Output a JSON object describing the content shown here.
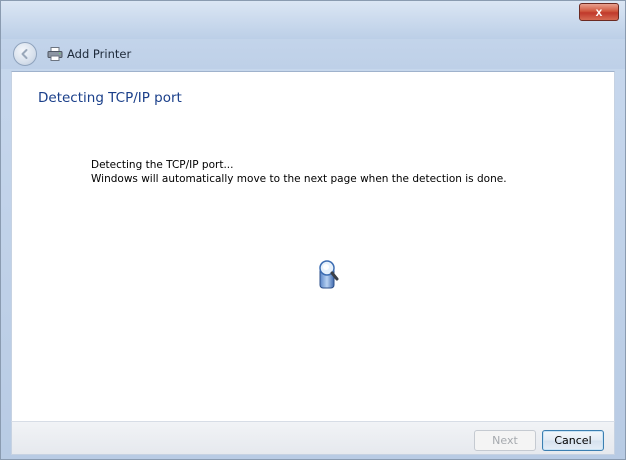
{
  "window": {
    "title": "Add Printer",
    "close_label": "x"
  },
  "page": {
    "heading": "Detecting TCP/IP port",
    "status_line1": "Detecting the TCP/IP port...",
    "status_line2": "Windows will automatically move to the next page when the detection is done."
  },
  "buttons": {
    "next_label": "Next",
    "next_enabled": false,
    "cancel_label": "Cancel"
  },
  "icons": {
    "back": "back-arrow-icon",
    "printer": "printer-icon",
    "searching": "search-animation-icon"
  },
  "colors": {
    "heading": "#1a3f8a",
    "close_button": "#c0392b",
    "disabled_text": "#a5a9ae"
  }
}
